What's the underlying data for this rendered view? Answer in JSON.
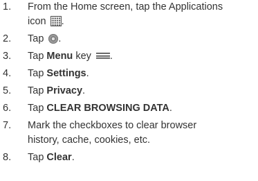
{
  "steps": [
    {
      "number": "1.",
      "line1": "From the Home screen, tap the Applications",
      "line2": "icon",
      "after": ".",
      "icon": "applications-grid-icon"
    },
    {
      "number": "2.",
      "before": "Tap",
      "after": ".",
      "icon": "browser-icon"
    },
    {
      "number": "3.",
      "before": "Tap",
      "bold": "Menu",
      "middle": "key",
      "after": ".",
      "icon": "menu-key-icon"
    },
    {
      "number": "4.",
      "before": "Tap",
      "bold": "Settings",
      "after": "."
    },
    {
      "number": "5.",
      "before": "Tap",
      "bold": "Privacy",
      "after": "."
    },
    {
      "number": "6.",
      "before": "Tap",
      "bold": "CLEAR BROWSING DATA",
      "after": "."
    },
    {
      "number": "7.",
      "line1": "Mark the checkboxes to clear browser",
      "line2": "history, cache, cookies, etc."
    },
    {
      "number": "8.",
      "before": "Tap",
      "bold": "Clear",
      "after": "."
    }
  ]
}
